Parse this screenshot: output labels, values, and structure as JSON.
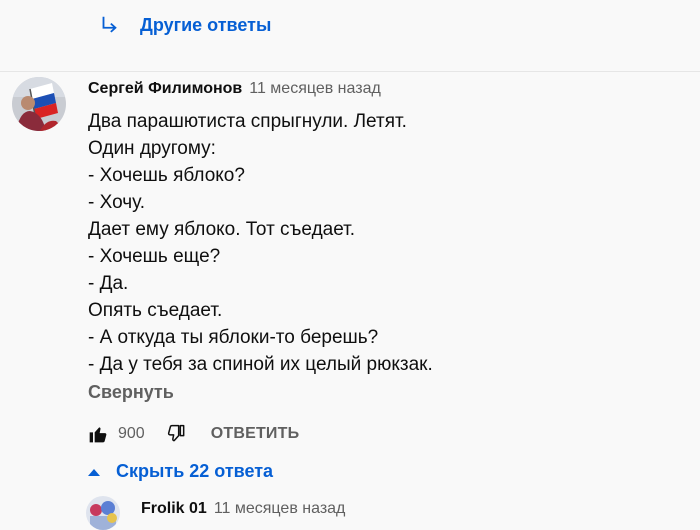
{
  "more_replies": {
    "label": "Другие ответы",
    "icon": "reply-arrow-icon"
  },
  "comment": {
    "author": "Сергей Филимонов",
    "time": "11 месяцев назад",
    "lines": [
      "Два парашютиста спрыгнули. Летят.",
      "Один другому:",
      "- Хочешь яблоко?",
      "- Хочу.",
      "Дает ему яблоко. Тот съедает.",
      "- Хочешь еще?",
      "- Да.",
      "Опять съедает.",
      "- А откуда ты яблоки-то берешь?",
      "- Да у тебя за спиной их целый рюкзак."
    ],
    "collapse_label": "Свернуть",
    "likes": "900",
    "reply_label": "ОТВЕТИТЬ"
  },
  "hide_replies": {
    "label": "Скрыть 22 ответа",
    "icon": "caret-up-icon"
  },
  "reply": {
    "author": "Frolik 01",
    "time": "11 месяцев назад"
  },
  "colors": {
    "accent": "#065fd4",
    "secondary_text": "#606060",
    "text": "#0f0f0f"
  }
}
